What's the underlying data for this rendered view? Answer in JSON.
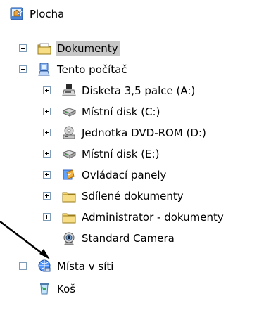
{
  "tree": {
    "root": {
      "label": "Plocha",
      "icon": "desktop-icon"
    },
    "documents": {
      "label": "Dokumenty",
      "icon": "documents-folder-icon",
      "selected": true
    },
    "computer": {
      "label": "Tento počítač",
      "icon": "computer-icon"
    },
    "floppy": {
      "label": "Disketa 3,5 palce (A:)",
      "icon": "floppy-drive-icon"
    },
    "disk_c": {
      "label": "Místní disk (C:)",
      "icon": "hard-disk-icon"
    },
    "dvd": {
      "label": "Jednotka DVD-ROM (D:)",
      "icon": "dvd-drive-icon"
    },
    "disk_e": {
      "label": "Místní disk (E:)",
      "icon": "hard-disk-icon"
    },
    "control_panel": {
      "label": "Ovládací panely",
      "icon": "control-panel-icon"
    },
    "shared_docs": {
      "label": "Sdílené dokumenty",
      "icon": "folder-icon"
    },
    "admin_docs": {
      "label": "Administrator - dokumenty",
      "icon": "folder-icon"
    },
    "camera": {
      "label": "Standard Camera",
      "icon": "camera-icon"
    },
    "network": {
      "label": "Místa v síti",
      "icon": "network-places-icon"
    },
    "recycle": {
      "label": "Koš",
      "icon": "recycle-bin-icon"
    }
  },
  "colors": {
    "selection": "#c7c7c7",
    "expander_border": "#7f9db9",
    "folder": "#f4d36a",
    "arrow": "#000000"
  }
}
